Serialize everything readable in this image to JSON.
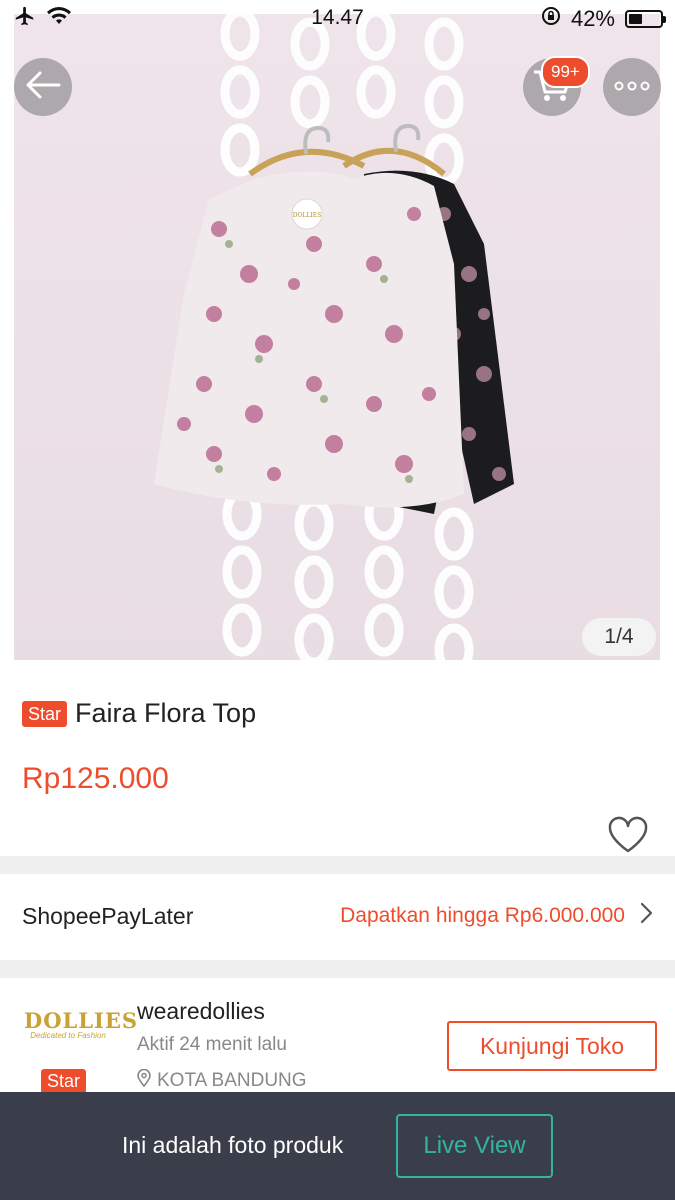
{
  "status_bar": {
    "time": "14.47",
    "battery_percent": "42%",
    "battery_level": 0.42
  },
  "product": {
    "image_counter": "1/4",
    "cart_badge": "99+",
    "star_badge": "Star",
    "title": "Faira Flora Top",
    "price": "Rp125.000",
    "tag_label": "DOLLIES"
  },
  "paylater": {
    "label": "ShopeePayLater",
    "offer": "Dapatkan hingga Rp6.000.000"
  },
  "shop": {
    "logo_text": "DOLLIES",
    "logo_subtext": "Dedicated to Fashion",
    "star_badge": "Star",
    "name": "wearedollies",
    "active_status": "Aktif 24 menit lalu",
    "location": "KOTA BANDUNG",
    "visit_button": "Kunjungi Toko"
  },
  "bottom_banner": {
    "text": "Ini adalah foto produk",
    "live_button": "Live View"
  },
  "colors": {
    "accent": "#ee4d2d",
    "live_view": "#36b3a0",
    "banner_bg": "#3a3e4a"
  },
  "icons": [
    "airplane-icon",
    "wifi-icon",
    "rotation-lock-icon",
    "battery-icon",
    "back-arrow-icon",
    "cart-icon",
    "more-icon",
    "heart-icon",
    "chevron-right-icon",
    "location-pin-icon"
  ]
}
